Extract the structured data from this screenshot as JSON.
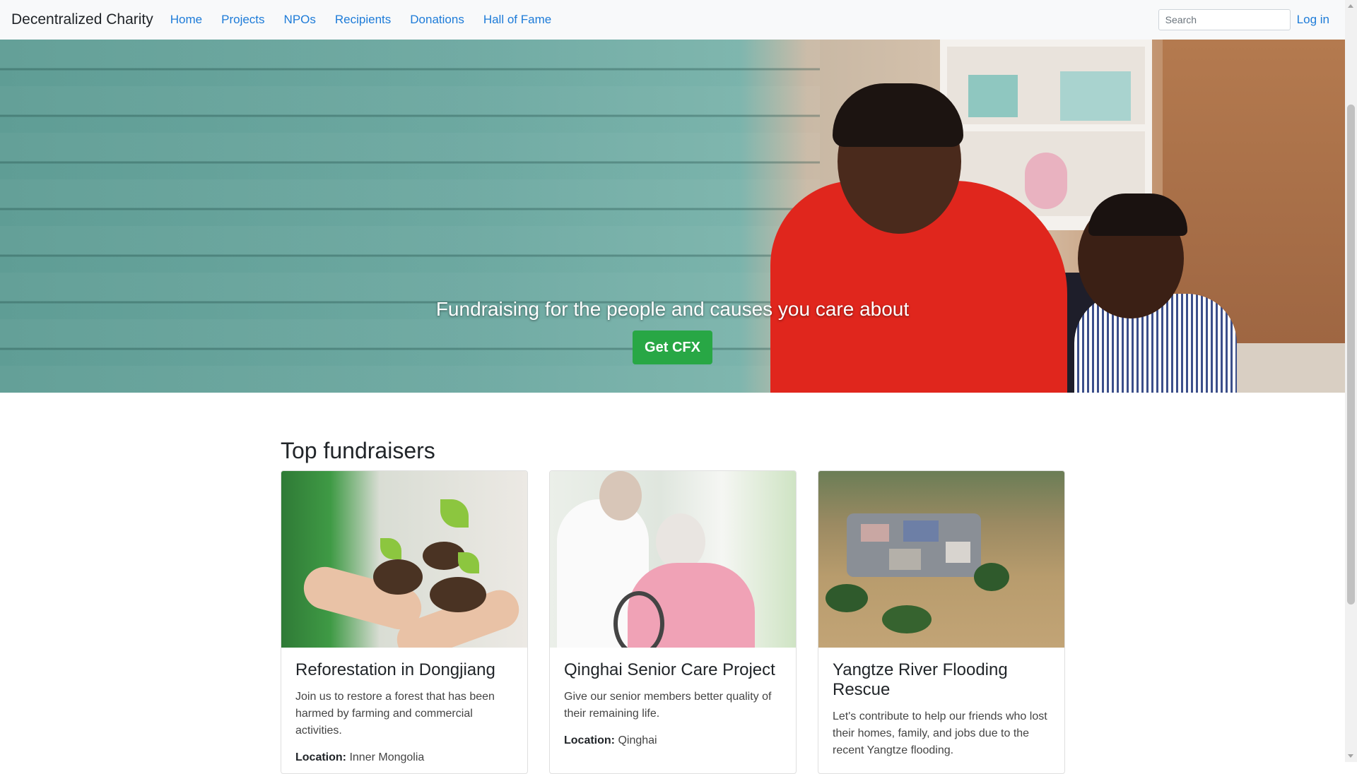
{
  "navbar": {
    "brand": "Decentralized Charity",
    "links": [
      "Home",
      "Projects",
      "NPOs",
      "Recipients",
      "Donations",
      "Hall of Fame"
    ],
    "search_placeholder": "Search",
    "login": "Log in"
  },
  "hero": {
    "title": "Fundraising for the people and causes you care about",
    "cta": "Get CFX"
  },
  "main": {
    "section_title": "Top fundraisers",
    "location_label": "Location:",
    "cards": [
      {
        "title": "Reforestation in Dongjiang",
        "description": "Join us to restore a forest that has been harmed by farming and commercial activities.",
        "location": "Inner Mongolia"
      },
      {
        "title": "Qinghai Senior Care Project",
        "description": "Give our senior members better quality of their remaining life.",
        "location": "Qinghai"
      },
      {
        "title": "Yangtze River Flooding Rescue",
        "description": "Let's contribute to help our friends who lost their homes, family, and jobs due to the recent Yangtze flooding.",
        "location": ""
      }
    ]
  },
  "colors": {
    "link": "#1d7bd8",
    "cta": "#28a745",
    "navbar_bg": "#f8f9fa"
  }
}
